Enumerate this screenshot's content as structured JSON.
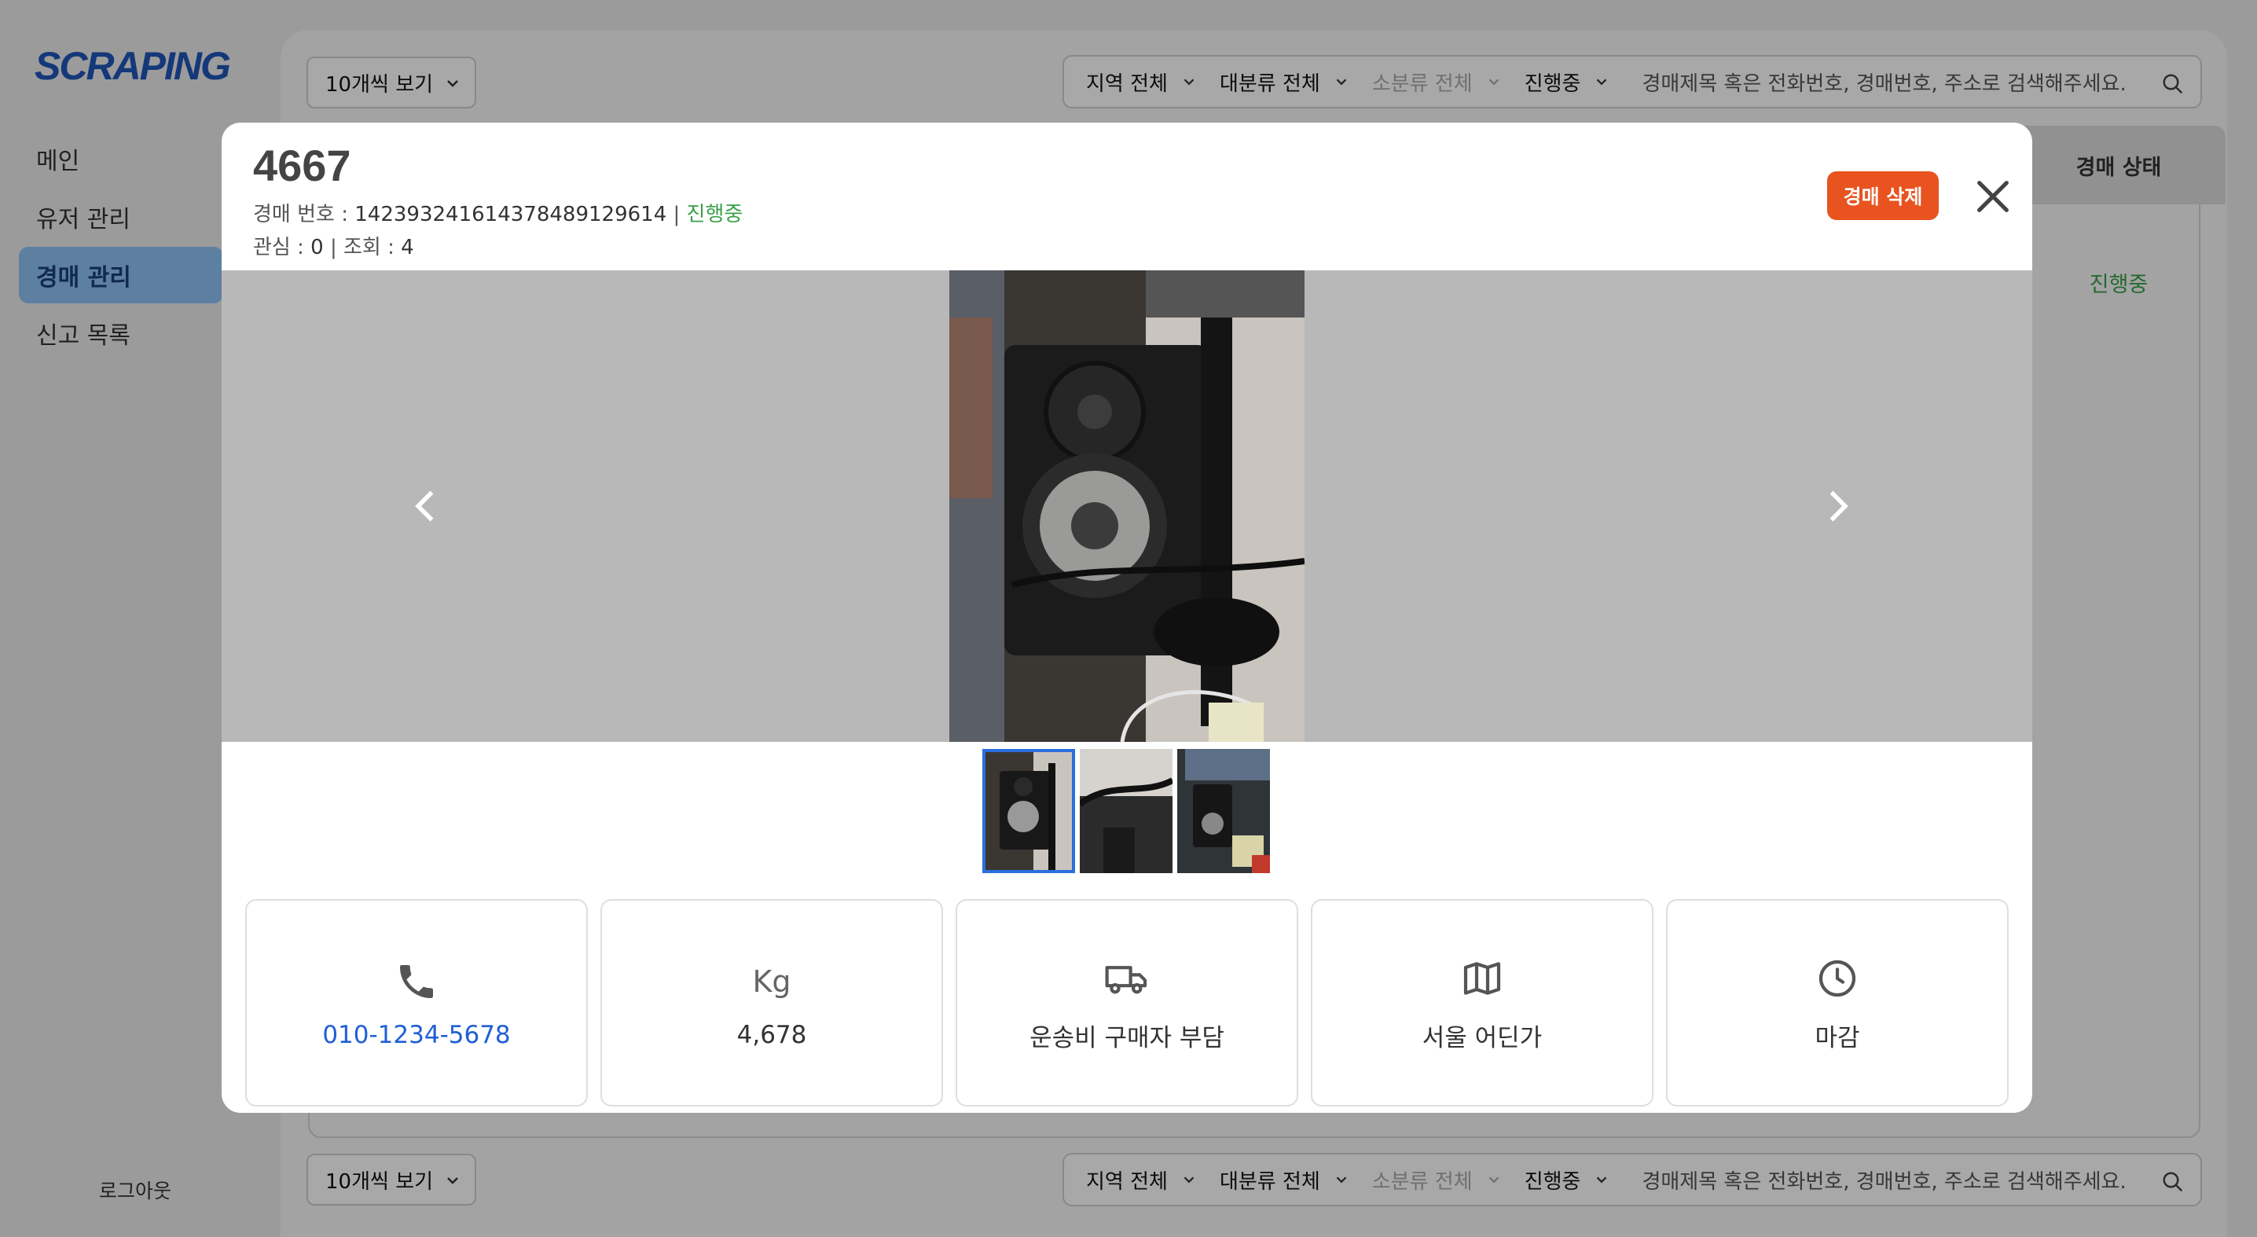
{
  "app": {
    "logo": "SCRAPING"
  },
  "sidebar": {
    "items": [
      {
        "label": "메인"
      },
      {
        "label": "유저 관리"
      },
      {
        "label": "경매 관리"
      },
      {
        "label": "신고 목록"
      }
    ],
    "logout": "로그아웃"
  },
  "toolbar": {
    "page_size": "10개씩 보기",
    "filters": {
      "region": "지역 전체",
      "major": "대분류 전체",
      "minor": "소분류 전체",
      "status": "진행중"
    },
    "search_placeholder": "경매제목 혹은 전화번호, 경매번호, 주소로 검색해주세요."
  },
  "table": {
    "status_header": "경매 상태",
    "row_status": "진행중"
  },
  "modal": {
    "title": "4667",
    "auction_label": "경매 번호 : ",
    "auction_number": "14239324161437848912961​4",
    "separator": " | ",
    "status": "진행중",
    "interest_label": "관심 : ",
    "interest_value": "0",
    "views_label": "조회 : ",
    "views_value": "4",
    "delete_label": "경매 삭제",
    "thumb_count": 3,
    "info": {
      "phone": "010-1234-5678",
      "weight_unit": "Kg",
      "weight": "4,678",
      "shipping": "운송비 구매자 부담",
      "location": "서울 어딘가",
      "deadline": "마감"
    }
  },
  "colors": {
    "accent": "#1f55b8",
    "delete": "#e8531f",
    "status_green": "#3aa04a",
    "link": "#1f5fd6"
  }
}
